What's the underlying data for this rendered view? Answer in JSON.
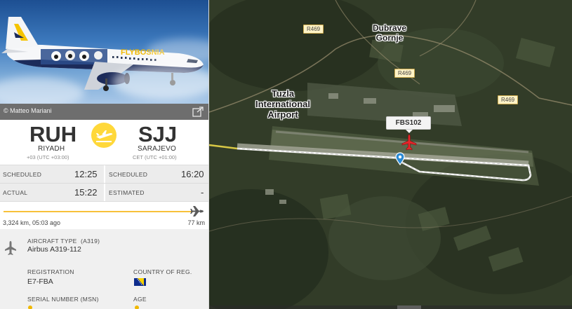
{
  "photo": {
    "credit": "© Matteo Mariani",
    "livery_text": "FLYBOSNIA"
  },
  "origin": {
    "code": "RUH",
    "city": "RIYADH",
    "tz": "+03 (UTC +03:00)"
  },
  "destination": {
    "code": "SJJ",
    "city": "SARAJEVO",
    "tz": "CET (UTC +01:00)"
  },
  "times": {
    "scheduled_label": "SCHEDULED",
    "actual_label": "ACTUAL",
    "estimated_label": "ESTIMATED",
    "dep_scheduled": "12:25",
    "dep_actual": "15:22",
    "arr_scheduled": "16:20",
    "arr_estimated": "-"
  },
  "progress": {
    "fraction": 0.977,
    "left_text": "3,324 km, 05:03 ago",
    "right_text": "77 km"
  },
  "aircraft": {
    "type_label": "AIRCRAFT TYPE",
    "type_code": "(A319)",
    "type_value": "Airbus A319-112",
    "registration_label": "REGISTRATION",
    "registration_value": "E7-FBA",
    "country_label": "COUNTRY OF REG.",
    "serial_label": "SERIAL NUMBER (MSN)",
    "age_label": "AGE"
  },
  "map": {
    "roads": [
      "R469",
      "R469",
      "R469"
    ],
    "places": {
      "village_line1": "Dubrave",
      "village_line2": "Gornje",
      "airport_line1": "Tuzla",
      "airport_line2": "International",
      "airport_line3": "Airport"
    },
    "flight_label": "FBS102"
  },
  "colors": {
    "accent_yellow": "#ffd83a",
    "progress": "#f7c13a",
    "plane_marker": "#e8262b",
    "pin": "#2a8ad4"
  }
}
